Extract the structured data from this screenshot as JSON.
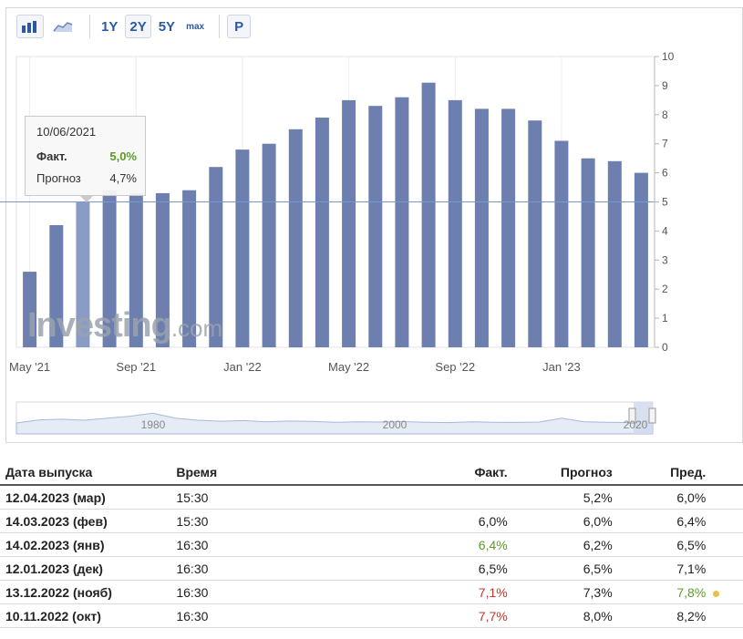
{
  "toolbar": {
    "range_1y": "1Y",
    "range_2y": "2Y",
    "range_5y": "5Y",
    "range_max": "max",
    "prognoz_btn": "P"
  },
  "tooltip": {
    "date": "10/06/2021",
    "actual_label": "Факт.",
    "actual_value": "5,0%",
    "forecast_label": "Прогноз",
    "forecast_value": "4,7%"
  },
  "watermark": {
    "brand": "Investing",
    "suffix": ".com"
  },
  "colors": {
    "bar": "#6c7faf",
    "bar_highlight": "#8a9bc6",
    "reference_line": "#7a98c9",
    "positive": "#5b9a2b",
    "negative": "#c0392b"
  },
  "chart_data": {
    "type": "bar",
    "categories": [
      "2021-05",
      "2021-06",
      "2021-07",
      "2021-08",
      "2021-09",
      "2021-10",
      "2021-11",
      "2021-12",
      "2022-01",
      "2022-02",
      "2022-03",
      "2022-04",
      "2022-05",
      "2022-06",
      "2022-07",
      "2022-08",
      "2022-09",
      "2022-10",
      "2022-11",
      "2022-12",
      "2023-01",
      "2023-02",
      "2023-03"
    ],
    "values": [
      2.6,
      4.2,
      5.0,
      5.4,
      5.3,
      5.3,
      5.4,
      6.2,
      6.8,
      7.0,
      7.5,
      7.9,
      8.5,
      8.3,
      8.6,
      9.1,
      8.5,
      8.2,
      8.2,
      7.8,
      7.1,
      6.5,
      6.4,
      6.0
    ],
    "x_tick_labels": [
      "May '21",
      "Sep '21",
      "Jan '22",
      "May '22",
      "Sep '22",
      "Jan '23"
    ],
    "y_ticks": [
      "0",
      "1",
      "2",
      "3",
      "4",
      "5",
      "6",
      "7",
      "8",
      "9",
      "10"
    ],
    "ylim": [
      0,
      10
    ],
    "reference_value": 5.0,
    "highlighted_index": 2,
    "navigator_labels": [
      "1980",
      "2000",
      "2020"
    ]
  },
  "table": {
    "headers": {
      "date": "Дата выпуска",
      "time": "Время",
      "actual": "Факт.",
      "forecast": "Прогноз",
      "previous": "Пред."
    },
    "rows": [
      {
        "date": "12.04.2023 (мар)",
        "time": "15:30",
        "actual": "",
        "forecast": "5,2%",
        "previous": "6,0%"
      },
      {
        "date": "14.03.2023 (фев)",
        "time": "15:30",
        "actual": "6,0%",
        "forecast": "6,0%",
        "previous": "6,4%"
      },
      {
        "date": "14.02.2023 (янв)",
        "time": "16:30",
        "actual": "6,4%",
        "forecast": "6,2%",
        "previous": "6,5%"
      },
      {
        "date": "12.01.2023 (дек)",
        "time": "16:30",
        "actual": "6,5%",
        "forecast": "6,5%",
        "previous": "7,1%"
      },
      {
        "date": "13.12.2022 (нояб)",
        "time": "16:30",
        "actual": "7,1%",
        "forecast": "7,3%",
        "previous": "7,8%"
      },
      {
        "date": "10.11.2022 (окт)",
        "time": "16:30",
        "actual": "7,7%",
        "forecast": "8,0%",
        "previous": "8,2%"
      }
    ]
  }
}
